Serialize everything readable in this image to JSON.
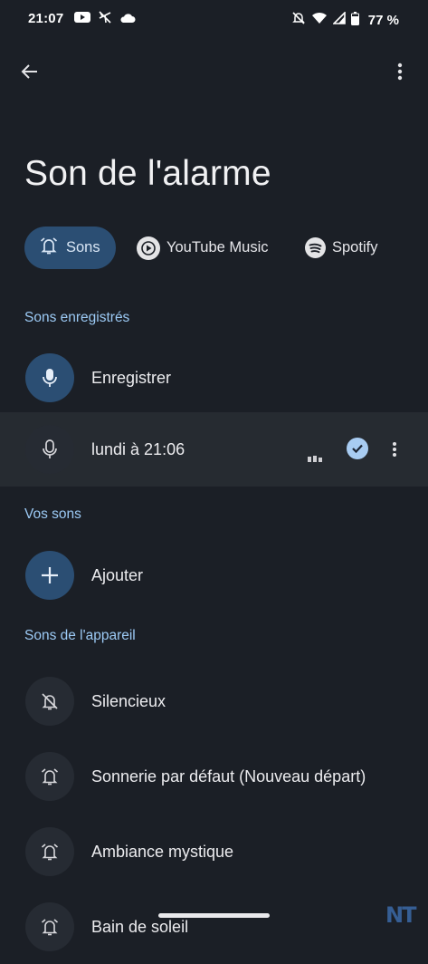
{
  "status_bar": {
    "time": "21:07",
    "left_icons": [
      "youtube-icon",
      "flight-mode-icon",
      "cloud-icon"
    ],
    "right_icons": [
      "notifications-off-icon",
      "wifi-icon",
      "signal-icon",
      "battery-icon"
    ],
    "battery": "77 %"
  },
  "top_bar": {
    "back_icon": "arrow-back-icon",
    "more_icon": "more-vert-icon"
  },
  "page": {
    "title": "Son de l'alarme"
  },
  "tabs": [
    {
      "label": "Sons",
      "icon": "alarm-bell-icon",
      "selected": true
    },
    {
      "label": "YouTube Music",
      "icon": "youtube-music-icon",
      "selected": false
    },
    {
      "label": "Spotify",
      "icon": "spotify-icon",
      "selected": false
    }
  ],
  "sections": {
    "recorded": {
      "header": "Sons enregistrés",
      "items": [
        {
          "label": "Enregistrer",
          "icon": "mic-icon"
        },
        {
          "label": "lundi à 21:06",
          "icon": "mic-icon",
          "selected": true
        }
      ]
    },
    "yours": {
      "header": "Vos sons",
      "items": [
        {
          "label": "Ajouter",
          "icon": "add-icon"
        }
      ]
    },
    "device": {
      "header": "Sons de l'appareil",
      "items": [
        {
          "label": "Silencieux",
          "icon": "alarm-off-icon"
        },
        {
          "label": "Sonnerie par défaut (Nouveau départ)",
          "icon": "alarm-bell-icon"
        },
        {
          "label": "Ambiance mystique",
          "icon": "alarm-bell-icon"
        },
        {
          "label": "Bain de soleil",
          "icon": "alarm-bell-icon"
        }
      ]
    }
  },
  "colors": {
    "background": "#1b1f26",
    "accent": "#2b4e73",
    "section_header": "#9ccaf5",
    "selected_row": "#262b31"
  },
  "watermark": "NT"
}
